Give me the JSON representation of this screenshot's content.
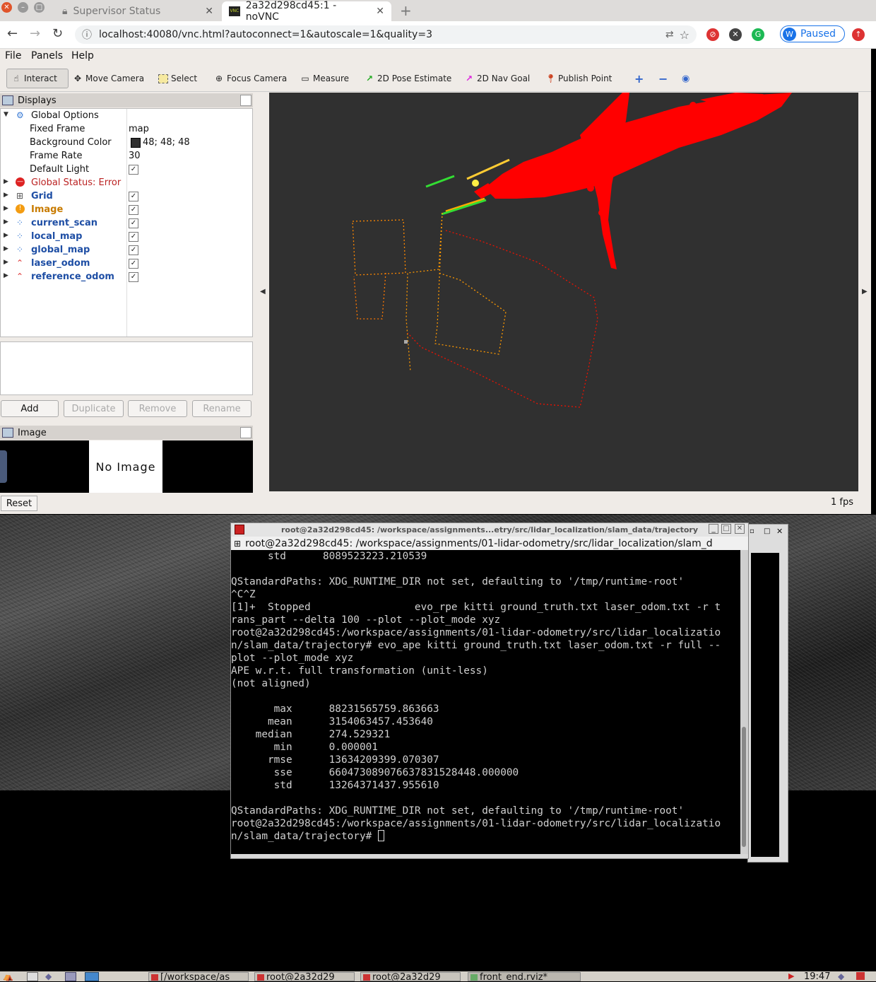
{
  "browser": {
    "tabs": [
      {
        "title": "Supervisor Status",
        "active": false
      },
      {
        "title": "2a32d298cd45:1 - noVNC",
        "active": true
      }
    ],
    "url": "localhost:40080/vnc.html?autoconnect=1&autoscale=1&quality=3",
    "profile_initial": "W",
    "profile_status": "Paused"
  },
  "rviz": {
    "menu": [
      "File",
      "Panels",
      "Help"
    ],
    "tools": [
      {
        "label": "Interact",
        "icon": "hand-icon"
      },
      {
        "label": "Move Camera",
        "icon": "move-icon"
      },
      {
        "label": "Select",
        "icon": "select-icon"
      },
      {
        "label": "Focus Camera",
        "icon": "focus-icon"
      },
      {
        "label": "Measure",
        "icon": "ruler-icon"
      },
      {
        "label": "2D Pose Estimate",
        "icon": "green-arrow-icon"
      },
      {
        "label": "2D Nav Goal",
        "icon": "pink-arrow-icon"
      },
      {
        "label": "Publish Point",
        "icon": "pin-icon"
      }
    ],
    "displays_title": "Displays",
    "global_options": {
      "label": "Global Options",
      "fixed_frame_label": "Fixed Frame",
      "fixed_frame": "map",
      "bg_color_label": "Background Color",
      "bg_color": "48; 48; 48",
      "frame_rate_label": "Frame Rate",
      "frame_rate": "30",
      "default_light_label": "Default Light"
    },
    "global_status": "Global Status: Error",
    "displays": [
      "Grid",
      "Image",
      "current_scan",
      "local_map",
      "global_map",
      "laser_odom",
      "reference_odom"
    ],
    "buttons": {
      "add": "Add",
      "duplicate": "Duplicate",
      "remove": "Remove",
      "rename": "Rename"
    },
    "image_panel_title": "Image",
    "no_image": "No Image",
    "reset": "Reset",
    "fps": "1 fps"
  },
  "terminal": {
    "title": "root@2a32d298cd45: /workspace/assignments...etry/src/lidar_localization/slam_data/trajectory",
    "tab": "root@2a32d298cd45: /workspace/assignments/01-lidar-odometry/src/lidar_localization/slam_d",
    "lines": [
      "      std      8089523223.210539",
      "",
      "QStandardPaths: XDG_RUNTIME_DIR not set, defaulting to '/tmp/runtime-root'",
      "^C^Z",
      "[1]+  Stopped                 evo_rpe kitti ground_truth.txt laser_odom.txt -r t",
      "rans_part --delta 100 --plot --plot_mode xyz",
      "root@2a32d298cd45:/workspace/assignments/01-lidar-odometry/src/lidar_localizatio",
      "n/slam_data/trajectory# evo_ape kitti ground_truth.txt laser_odom.txt -r full --",
      "plot --plot_mode xyz",
      "APE w.r.t. full transformation (unit-less)",
      "(not aligned)",
      "",
      "       max      88231565759.863663",
      "      mean      3154063457.453640",
      "    median      274.529321",
      "       min      0.000001",
      "      rmse      13634209399.070307",
      "       sse      660473089076637831528448.000000",
      "       std      13264371437.955610",
      "",
      "QStandardPaths: XDG_RUNTIME_DIR not set, defaulting to '/tmp/runtime-root'",
      "root@2a32d298cd45:/workspace/assignments/01-lidar-odometry/src/lidar_localizatio",
      "n/slam_data/trajectory# "
    ]
  },
  "taskbar": {
    "tasks": [
      "[/workspace/as",
      "root@2a32d29",
      "root@2a32d29",
      "front_end.rviz*"
    ],
    "clock": "19:47"
  },
  "colors": {
    "viewport_bg": "#303030",
    "map_points": "#ff0000",
    "reference_path": "#ff8800",
    "link_blue": "#1f4fa5",
    "error": "#b22222"
  }
}
